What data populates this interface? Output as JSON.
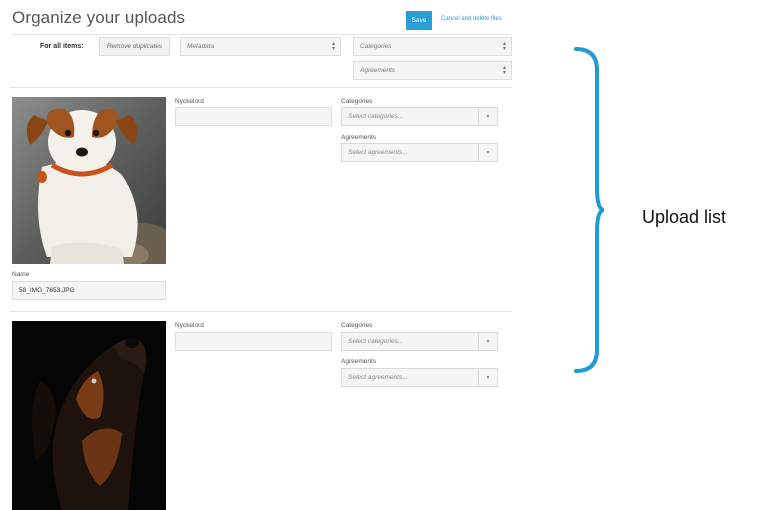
{
  "page": {
    "title": "Organize your uploads"
  },
  "toolbar": {
    "save_label": "Save",
    "cancel_label": "Cancel and delete files"
  },
  "bulk": {
    "for_all_label": "For all items:",
    "remove_duplicates": "Remove duplicates",
    "metadata": "Metadata",
    "categories": "Categories",
    "agreements": "Agreements"
  },
  "items": [
    {
      "keywords_label": "Nyckelord",
      "keywords_value": "",
      "categories_label": "Categories",
      "categories_placeholder": "Select categories...",
      "agreements_label": "Agreements",
      "agreements_placeholder": "Select agreements...",
      "name_label": "Name",
      "name_value": "58_IMG_7653.JPG"
    },
    {
      "keywords_label": "Nyckelord",
      "keywords_value": "",
      "categories_label": "Categories",
      "categories_placeholder": "Select categories...",
      "agreements_label": "Agreements",
      "agreements_placeholder": "Select agreements..."
    }
  ],
  "annotation": {
    "label": "Upload list",
    "color": "#1f9bd8"
  },
  "colors": {
    "accent": "#2a9fd6"
  }
}
